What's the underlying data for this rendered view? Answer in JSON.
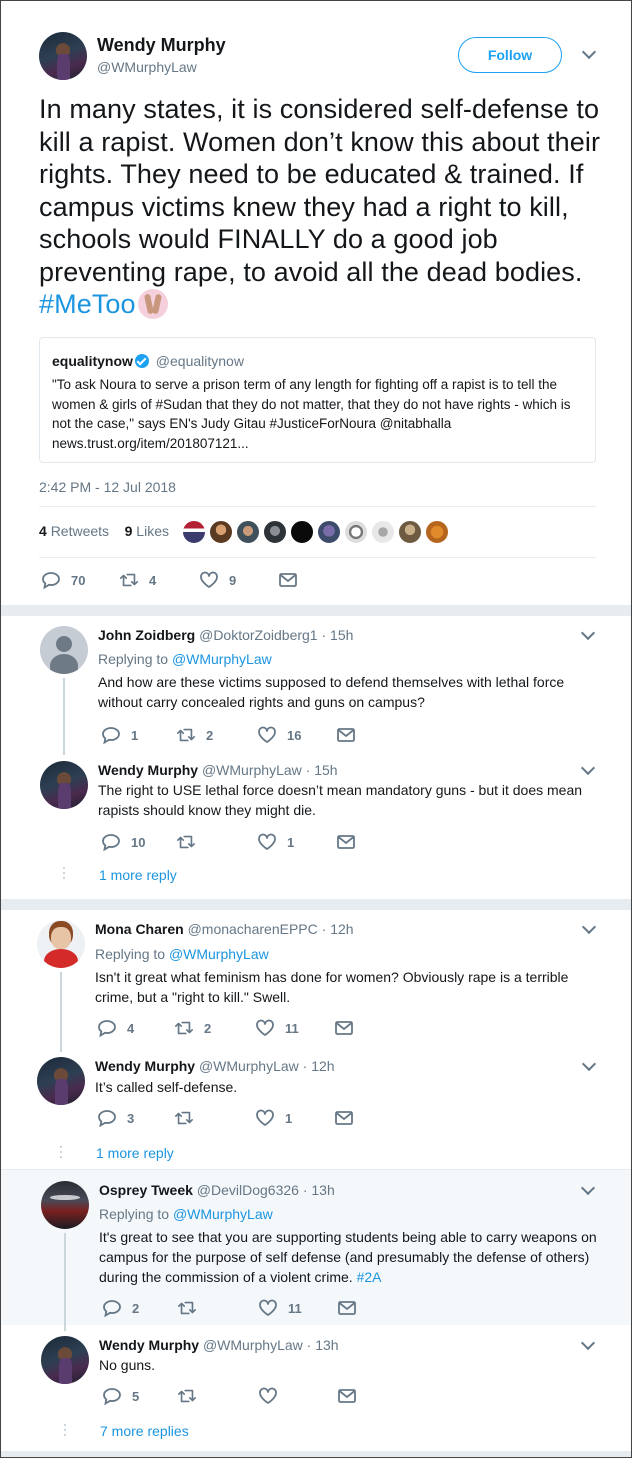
{
  "main_tweet": {
    "author_name": "Wendy Murphy",
    "author_handle": "@WMurphyLaw",
    "follow_label": "Follow",
    "text": "In many states, it is considered self-defense to kill a rapist. Women don’t know this about their rights. They need to be educated & trained. If campus victims knew they had a right to kill, schools would FINALLY do a good job preventing rape, to avoid all the dead bodies. ",
    "hashtag": "#MeToo",
    "quote": {
      "name": "equalitynow",
      "handle": "@equalitynow",
      "text": "\"To ask Noura to serve a prison term of any length for fighting off a rapist is to tell the women & girls of #Sudan that they do not matter, that they do not have rights - which is not the case,\" says EN's Judy Gitau #JusticeForNoura @nitabhalla news.trust.org/item/201807121..."
    },
    "timestamp": "2:42 PM - 12 Jul 2018",
    "retweets_count": "4",
    "retweets_label": "Retweets",
    "likes_count": "9",
    "likes_label": "Likes",
    "actions": {
      "replies": "70",
      "retweets": "4",
      "likes": "9"
    }
  },
  "replies": [
    {
      "name": "John Zoidberg",
      "handle": "@DoktorZoidberg1",
      "time": "· 15h",
      "replying_prefix": "Replying to",
      "replying_to": "@WMurphyLaw",
      "text": "And how are these victims supposed to defend themselves with lethal force without carry concealed rights and guns on campus?",
      "actions": {
        "replies": "1",
        "retweets": "2",
        "likes": "16"
      }
    },
    {
      "name": "Wendy Murphy",
      "handle": "@WMurphyLaw",
      "time": "· 15h",
      "text": "The right to USE lethal force doesn’t mean mandatory guns - but it does mean rapists should know they might die.",
      "actions": {
        "replies": "10",
        "retweets": "",
        "likes": "1"
      },
      "more": "1 more reply"
    },
    {
      "name": "Mona Charen",
      "handle": "@monacharenEPPC",
      "time": "· 12h",
      "replying_prefix": "Replying to",
      "replying_to": "@WMurphyLaw",
      "text": "Isn't it great what feminism has done for women? Obviously rape is a terrible crime, but a \"right to kill.\" Swell.",
      "actions": {
        "replies": "4",
        "retweets": "2",
        "likes": "11"
      }
    },
    {
      "name": "Wendy Murphy",
      "handle": "@WMurphyLaw",
      "time": "· 12h",
      "text": "It’s called self-defense.",
      "actions": {
        "replies": "3",
        "retweets": "",
        "likes": "1"
      },
      "more": "1 more reply"
    },
    {
      "name": "Osprey Tweek",
      "handle": "@DevilDog6326",
      "time": "· 13h",
      "replying_prefix": "Replying to",
      "replying_to": "@WMurphyLaw",
      "text": "It's great to see that you are supporting students being able to carry weapons on campus for the purpose of self defense (and presumably the defense of others) during the commission of a violent crime. ",
      "hashtag": "#2A",
      "actions": {
        "replies": "2",
        "retweets": "",
        "likes": "11"
      }
    },
    {
      "name": "Wendy Murphy",
      "handle": "@WMurphyLaw",
      "time": "· 13h",
      "text": "No guns.",
      "actions": {
        "replies": "5",
        "retweets": "",
        "likes": ""
      },
      "more": "7 more replies"
    }
  ],
  "colors": {
    "accent": "#1da1f2",
    "link": "#1b95e0",
    "muted": "#657786",
    "divider": "#e6ecf0"
  }
}
